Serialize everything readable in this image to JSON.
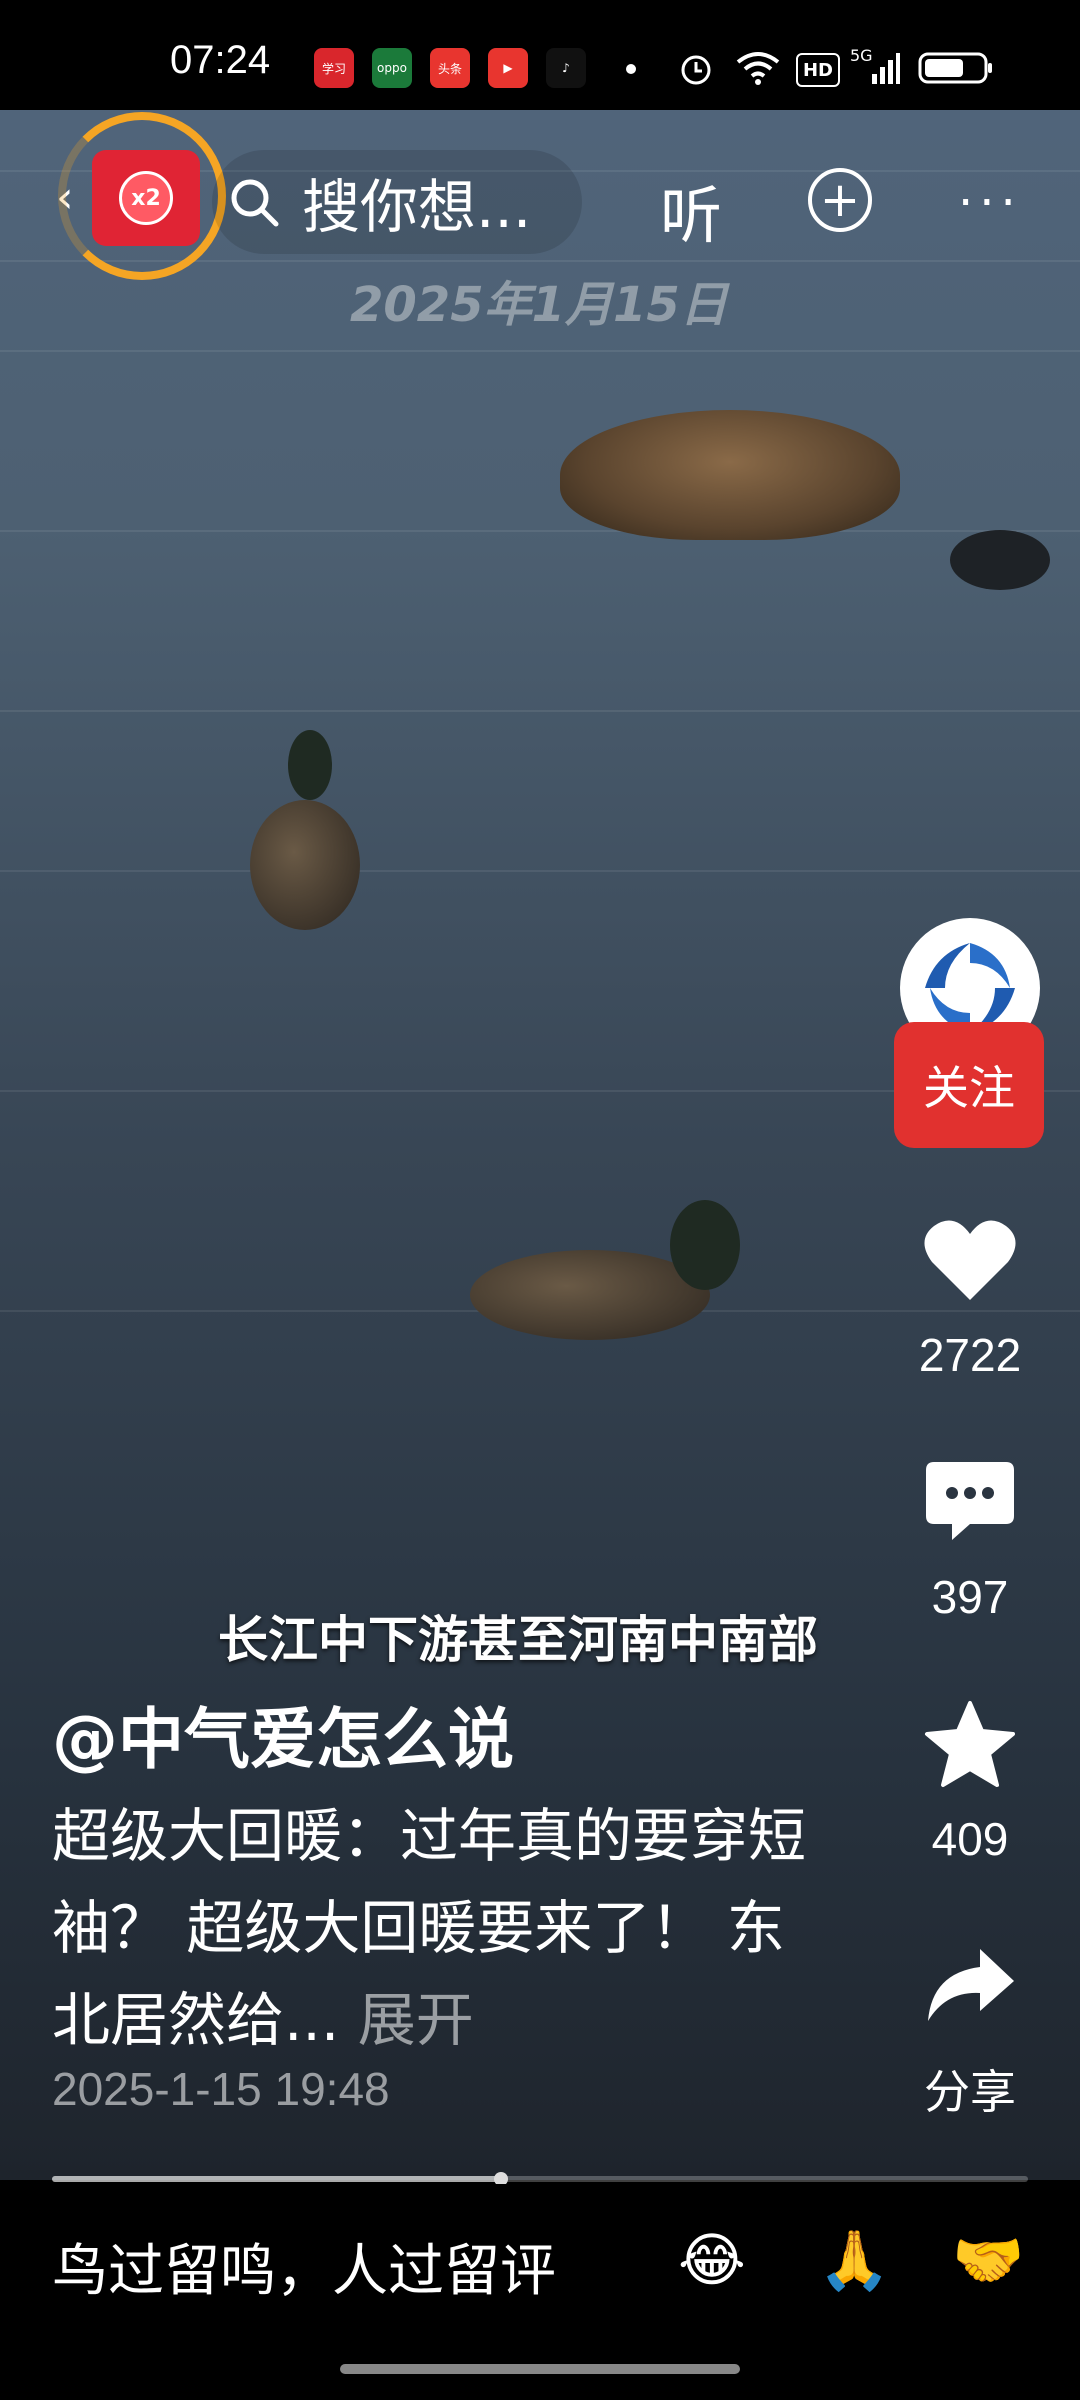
{
  "status_bar": {
    "time": "07:24",
    "apps": [
      {
        "name": "xuexi-app-icon",
        "label": "学习",
        "color": "#d9262c"
      },
      {
        "name": "oppo-app-icon",
        "label": "oppo",
        "color": "#1b7a3a"
      },
      {
        "name": "toutiao-app-icon",
        "label": "头条",
        "color": "#e8352f"
      },
      {
        "name": "video-app-icon",
        "label": "▶",
        "color": "#e8352f"
      },
      {
        "name": "douyin-app-icon",
        "label": "♪",
        "color": "#111111"
      }
    ],
    "hd": "HD",
    "signal": "5G"
  },
  "top_bar": {
    "redpacket_multiplier": "x2",
    "search_placeholder": "搜你想...",
    "listen_label": "听"
  },
  "video": {
    "date_watermark": "2025年1月15日",
    "subtitle": "长江中下游甚至河南中南部"
  },
  "side_actions": {
    "follow_label": "关注",
    "likes": "2722",
    "comments": "397",
    "favorites": "409",
    "share_label": "分享"
  },
  "post": {
    "author": "@中气爱怎么说",
    "description": "超级大回暖：过年真的要穿短袖？ 超级大回暖要来了！ 东北居然给...",
    "expand_label": "展开",
    "timestamp": "2025-1-15 19:48",
    "progress": 0.46
  },
  "bottom_bar": {
    "comment_placeholder": "鸟过留鸣，人过留评",
    "emojis": [
      "😂",
      "🙏",
      "🤝"
    ]
  }
}
